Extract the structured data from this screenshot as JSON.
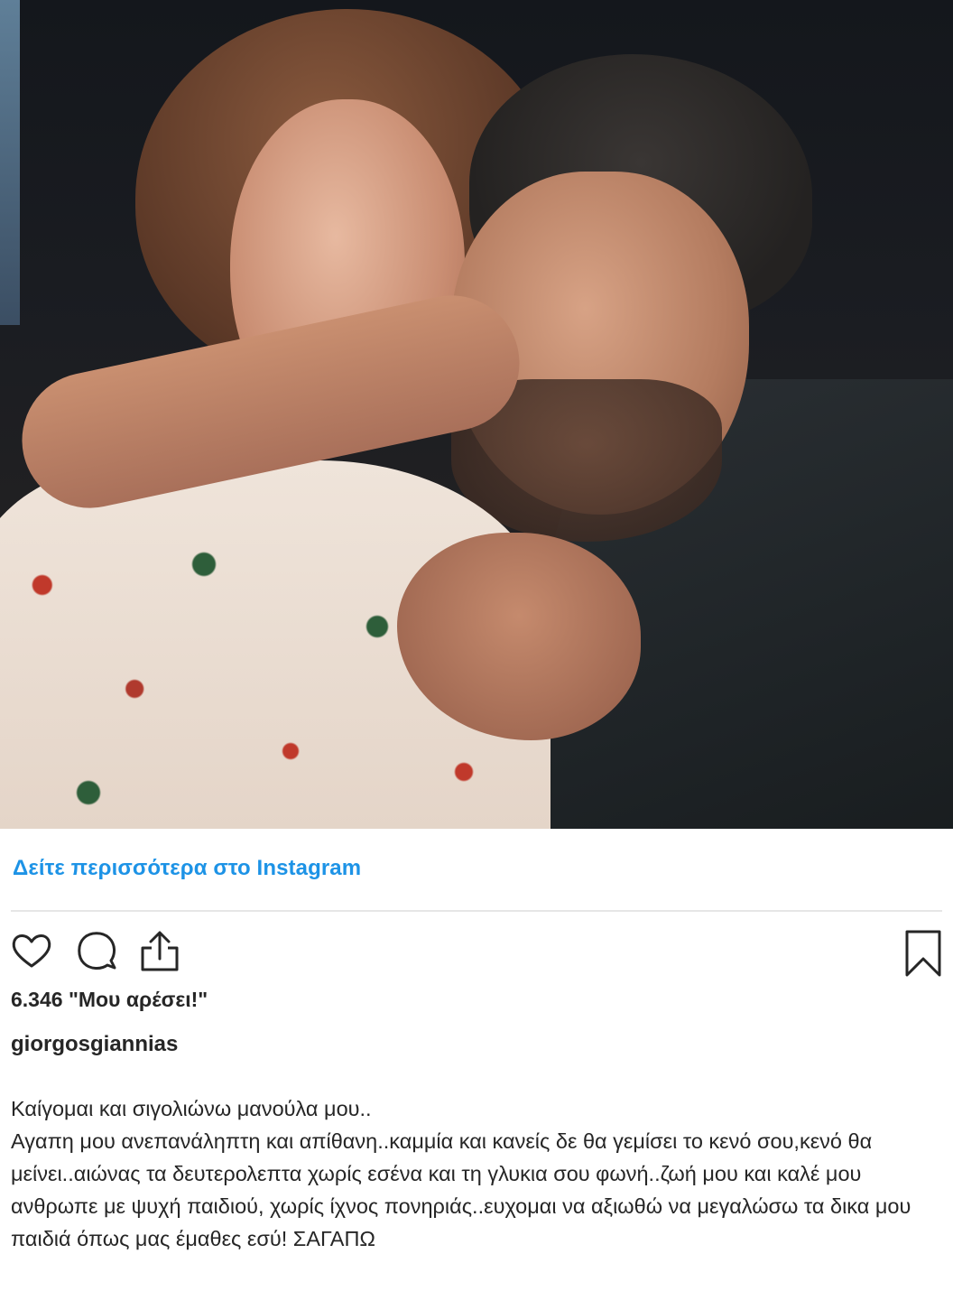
{
  "post": {
    "see_more": "Δείτε περισσότερα στο Instagram",
    "likes": "6.346 \"Μου αρέσει!\"",
    "username": "giorgosgiannias",
    "caption": "Καίγομαι και σιγολιώνω μανούλα μου..\nΑγαπη μου ανεπανάληπτη και απίθανη..καμμία και κανείς δε θα γεμίσει το κενό σου,κενό θα μείνει..αιώνας τα δευτερολεπτα χωρίς εσένα και τη γλυκια σου φωνή..ζωή μου και καλέ μου ανθρωπε με ψυχή παιδιού, χωρίς ίχνος πονηριάς..ευχομαι να αξιωθώ να μεγαλώσω τα δικα μου παιδιά όπως μας έμαθες εσύ! ΣΑΓΑΠΩ"
  },
  "icons": {
    "like": "heart-icon",
    "comment": "comment-icon",
    "share": "share-icon",
    "save": "bookmark-icon"
  },
  "colors": {
    "link": "#1d93e6",
    "text": "#262626",
    "divider": "#e6e6e6"
  }
}
